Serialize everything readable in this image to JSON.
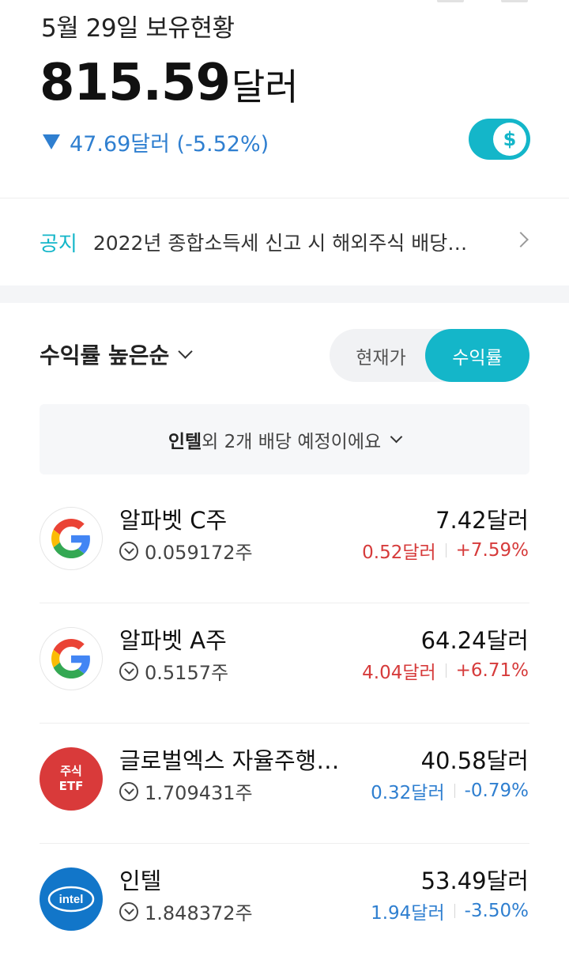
{
  "header": {
    "date_title": "5월 29일 보유현황",
    "total_amount": "815.59",
    "total_unit": "달러",
    "change_text": "47.69달러 (-5.52%)",
    "currency_toggle_symbol": "$"
  },
  "notice": {
    "tag": "공지",
    "text": "2022년 종합소득세 신고 시 해외주식 배당…"
  },
  "list_controls": {
    "sort_label": "수익률 높은순",
    "segment_price": "현재가",
    "segment_return": "수익률",
    "dividend_bold": "인텔",
    "dividend_rest": "외 2개 배당 예정이에요"
  },
  "stocks": [
    {
      "name": "알파벳 C주",
      "quantity": "0.059172주",
      "price": "7.42달러",
      "change_amount": "0.52달러",
      "change_pct": "+7.59%",
      "direction": "up",
      "logo": "google-icon"
    },
    {
      "name": "알파벳 A주",
      "quantity": "0.5157주",
      "price": "64.24달러",
      "change_amount": "4.04달러",
      "change_pct": "+6.71%",
      "direction": "up",
      "logo": "google-icon"
    },
    {
      "name": "글로벌엑스 자율주행…",
      "quantity": "1.709431주",
      "price": "40.58달러",
      "change_amount": "0.32달러",
      "change_pct": "-0.79%",
      "direction": "down",
      "logo": "etf-icon",
      "logo_line1": "주식",
      "logo_line2": "ETF"
    },
    {
      "name": "인텔",
      "quantity": "1.848372주",
      "price": "53.49달러",
      "change_amount": "1.94달러",
      "change_pct": "-3.50%",
      "direction": "down",
      "logo": "intel-icon",
      "logo_text": "intel"
    }
  ],
  "colors": {
    "accent": "#14b6c9",
    "up": "#d63b3b",
    "down": "#2f7fd0"
  }
}
